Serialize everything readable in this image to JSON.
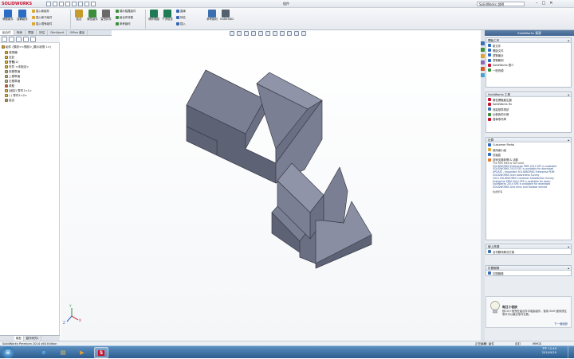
{
  "app": {
    "brand": "SOLIDWORKS",
    "doc_title": "組件",
    "search_placeholder": "SolidWorks 說明"
  },
  "window": {
    "minimize": "–",
    "maximize": "□",
    "close": "✕"
  },
  "ribbon": {
    "group1": [
      {
        "label": "移動組件",
        "icon": "move-component-icon",
        "color": "#2b6cc4"
      },
      {
        "label": "旋轉組件",
        "icon": "rotate-component-icon",
        "color": "#2b6cc4"
      }
    ],
    "group1_small": [
      {
        "label": "插入新組件",
        "icon": "new-part-icon",
        "color": "#e0a52b"
      },
      {
        "label": "插入新子組件",
        "icon": "new-assembly-icon",
        "color": "#e0a52b"
      },
      {
        "label": "插入現有組件",
        "icon": "existing-part-icon",
        "color": "#e0a52b"
      }
    ],
    "group2": [
      {
        "label": "結合",
        "icon": "mate-icon",
        "color": "#c79a2c"
      },
      {
        "label": "線性組件",
        "icon": "linear-pattern-icon",
        "color": "#3b8f3a"
      },
      {
        "label": "智慧扣件",
        "icon": "smart-fastener-icon",
        "color": "#6a6a6a"
      }
    ],
    "group3": [
      {
        "label": "顯示隱藏組件",
        "icon": "show-hidden-icon",
        "color": "#3b8f3a"
      },
      {
        "label": "組合件特徵",
        "icon": "assembly-features-icon",
        "color": "#3b8f3a"
      },
      {
        "label": "參考幾何",
        "icon": "reference-geometry-icon",
        "color": "#3b8f3a"
      }
    ],
    "group4": [
      {
        "label": "爆炸視圖",
        "icon": "exploded-view-icon",
        "color": "#1f7a56"
      },
      {
        "label": "干涉檢查",
        "icon": "interference-icon",
        "color": "#1f7a56"
      },
      {
        "label": "直線",
        "icon": "line-icon",
        "color": "#3367b5"
      },
      {
        "label": "評估",
        "icon": "evaluate-icon",
        "color": "#3367b5"
      },
      {
        "label": "插入",
        "icon": "insert-icon",
        "color": "#3367b5"
      }
    ],
    "group5": [
      {
        "label": "參考幾何",
        "icon": "ref-geometry-icon",
        "color": "#3b6fb0"
      },
      {
        "label": "InstantDD",
        "icon": "instant3d-icon",
        "color": "#55606e"
      }
    ]
  },
  "cm_tabs": [
    "組合件",
    "佈局",
    "草圖",
    "評估",
    "DimXpert",
    "Office 產品"
  ],
  "feature_tree": {
    "root": "組件 (預設<<預設>_顯示狀態 1>)",
    "items": [
      "感測器",
      "註記",
      "實體(2)",
      "材質 <未指定>",
      "前基準面",
      "上基準面",
      "右基準面",
      "原點",
      "(固定) 零件1<1>",
      "(-) 零件1<2>",
      "結合"
    ]
  },
  "bottom_tabs": [
    "模型",
    "動作研究1"
  ],
  "taskpane": {
    "title": "SolidWorks 資源",
    "sections": [
      {
        "title": "開始工作",
        "items": [
          "新文件",
          "開啟文件",
          "瀏覽最近",
          "瀏覽範例",
          "SolidWorks 簡介",
          "一般資源"
        ],
        "colors": [
          "#2b6cc4",
          "#2b6cc4",
          "#2b6cc4",
          "#2b6cc4",
          "#c8102e",
          "#3b8f3a"
        ]
      },
      {
        "title": "SolidWorks 工具",
        "items": [
          "屬性標籤產生器",
          "SolidWorks Rx",
          "效能基準測試",
          "比較我的分數",
          "搜尋零件庫"
        ],
        "colors": [
          "#c8102e",
          "#c8102e",
          "#3b6fb0",
          "#3b8f3a",
          "#c8102e"
        ]
      },
      {
        "title": "社群",
        "items": [
          "Customer Portal",
          "使用者小組",
          "討論區",
          "技術支援新聞 & 活動"
        ],
        "colors": [
          "#2b6cc4",
          "#e0a52b",
          "#2b6cc4",
          "#e07b2b"
        ]
      },
      {
        "title": "線上資源",
        "items": [
          "合作夥伴解決方案"
        ],
        "colors": [
          "#3b6fb0"
        ]
      },
      {
        "title": "訂閱服務",
        "items": [
          "訂閱服務"
        ],
        "colors": [
          "#3b6fb0"
        ]
      }
    ],
    "rss": [
      "The RSS feed is not valid.",
      "SOLIDWORKS Enterprise PDM 2015 SP1 is available.",
      "SOLIDWORKS 2015 SP1 is available for download",
      "UPDATE - Important SOLIDWORKS Enterprise PDM",
      "SOLIDWORKS User Awareness Survey",
      "2014 SOLIDWORKS Customer Satisfaction Survey",
      "Enterprise PDM 2014 SP4 is available for down",
      "SolidWorks 2014 SP4 is available for download",
      "SOLIDWORKS Anti-Virus and Toolbox service"
    ],
    "rss_more": "檢視所有",
    "tip_title": "每日小祕訣",
    "tip_text": "按Ctrl+拖曳在組合件中複製組件，使用 Shift 鍵來按住零件可以鎖定零件位置。",
    "tip_next": "下一個秘訣"
  },
  "status": {
    "text": "SolidWorks Premium 2014 x64 Edition",
    "right": [
      "正在編輯: 組件",
      "自訂",
      "MMGS"
    ]
  },
  "taskbar": {
    "time": "下午 12:49",
    "date": "2014/9/20",
    "apps": [
      {
        "name": "start-button",
        "glyph": "⊞"
      },
      {
        "name": "ie-icon",
        "glyph": "e"
      },
      {
        "name": "folder-icon",
        "glyph": "▤"
      },
      {
        "name": "media-player-icon",
        "glyph": "▶"
      },
      {
        "name": "solidworks-icon",
        "glyph": "S"
      }
    ]
  },
  "axis": {
    "x": "X",
    "y": "Y",
    "z": "Z"
  },
  "colors": {
    "model_top": "#7b7f93",
    "model_side": "#9094a8",
    "model_dark": "#5e6275",
    "edge": "#3b3d48",
    "accent": "#c8102e"
  }
}
